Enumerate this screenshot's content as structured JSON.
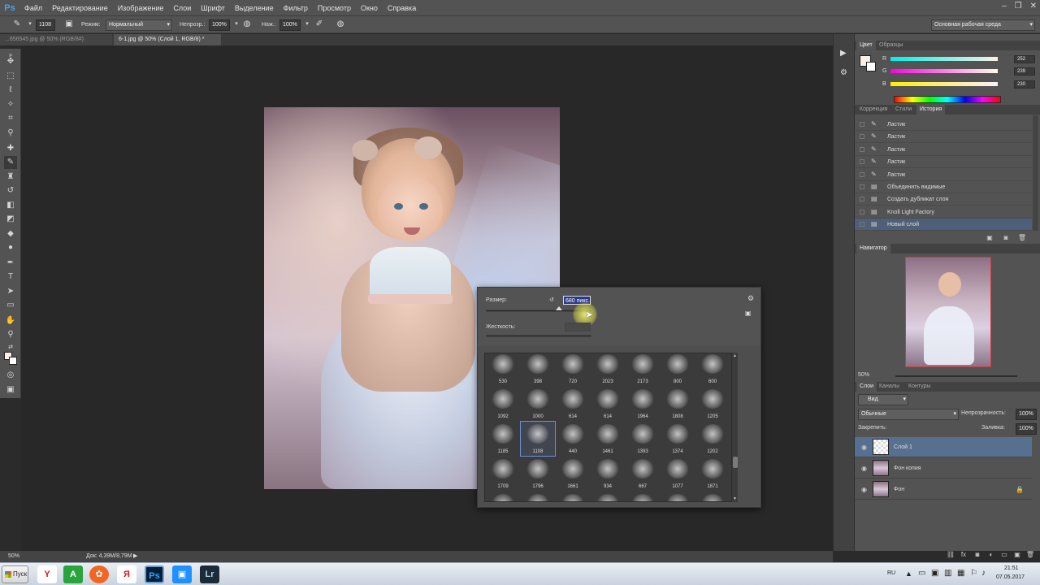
{
  "app": {
    "logo": "Ps"
  },
  "menu": [
    "Файл",
    "Редактирование",
    "Изображение",
    "Слои",
    "Шрифт",
    "Выделение",
    "Фильтр",
    "Просмотр",
    "Окно",
    "Справка"
  ],
  "window_controls": [
    "–",
    "❐",
    "✕"
  ],
  "options": {
    "size": "1108",
    "mode_label": "Режим:",
    "mode_value": "Нормальный",
    "opacity_label": "Непрозр.:",
    "opacity_value": "100%",
    "flow_label": "Наж.:",
    "flow_value": "100%",
    "workspace": "Основная рабочая среда"
  },
  "tabs": [
    {
      "label": "...656545.jpg @ 50% (RGB/8#)",
      "active": false
    },
    {
      "label": "6-1.jpg @ 50% (Слой 1, RGB/8) *",
      "active": true
    }
  ],
  "tools": [
    "move-tool",
    "marquee-tool",
    "lasso-tool",
    "quick-select-tool",
    "crop-tool",
    "eyedropper-tool",
    "healing-tool",
    "brush-tool",
    "stamp-tool",
    "history-brush-tool",
    "eraser-tool",
    "gradient-tool",
    "blur-tool",
    "dodge-tool",
    "pen-tool",
    "type-tool",
    "path-select-tool",
    "shape-tool",
    "hand-tool",
    "zoom-tool"
  ],
  "brush_picker": {
    "size_label": "Размер:",
    "size_value": "680 пикс.",
    "hardness_label": "Жесткость:",
    "brushes": [
      {
        "n": "530"
      },
      {
        "n": "398"
      },
      {
        "n": "720"
      },
      {
        "n": "2023"
      },
      {
        "n": "2173"
      },
      {
        "n": "800"
      },
      {
        "n": "600"
      },
      {
        "n": "1092"
      },
      {
        "n": "1000"
      },
      {
        "n": "614"
      },
      {
        "n": "614"
      },
      {
        "n": "1964"
      },
      {
        "n": "1808"
      },
      {
        "n": "1205"
      },
      {
        "n": "1185"
      },
      {
        "n": "1108",
        "selected": true
      },
      {
        "n": "440"
      },
      {
        "n": "1461"
      },
      {
        "n": "1393"
      },
      {
        "n": "1374"
      },
      {
        "n": "1202"
      },
      {
        "n": "1709"
      },
      {
        "n": "1796"
      },
      {
        "n": "1661"
      },
      {
        "n": "934"
      },
      {
        "n": "667"
      },
      {
        "n": "1077"
      },
      {
        "n": "1871"
      },
      {
        "n": ""
      },
      {
        "n": ""
      },
      {
        "n": ""
      },
      {
        "n": ""
      },
      {
        "n": ""
      },
      {
        "n": ""
      },
      {
        "n": ""
      }
    ]
  },
  "color_panel": {
    "tabs": [
      "Цвет",
      "Образцы"
    ],
    "r_label": "R",
    "g_label": "G",
    "b_label": "B",
    "r": "252",
    "g": "239",
    "b": "230"
  },
  "history_panel": {
    "tabs": [
      "Коррекция",
      "Стили",
      "История"
    ],
    "items": [
      {
        "label": "Ластик"
      },
      {
        "label": "Ластик"
      },
      {
        "label": "Ластик"
      },
      {
        "label": "Ластик"
      },
      {
        "label": "Ластик"
      },
      {
        "label": "Объединить видимые"
      },
      {
        "label": "Создать дубликат слоя"
      },
      {
        "label": "Knoll Light Factory"
      },
      {
        "label": "Новый слой",
        "active": true
      }
    ]
  },
  "navigator": {
    "tab": "Навигатор",
    "zoom": "50%"
  },
  "layers_panel": {
    "tabs": [
      "Слои",
      "Каналы",
      "Контуры"
    ],
    "kind": "Вид",
    "blend": "Обычные",
    "opacity_label": "Непрозрачность:",
    "opacity_value": "100%",
    "lock_label": "Закрепить:",
    "fill_label": "Заливка:",
    "fill_value": "100%",
    "layers": [
      {
        "name": "Слой 1",
        "active": true
      },
      {
        "name": "Фон копия"
      },
      {
        "name": "Фон",
        "locked": true
      }
    ]
  },
  "status": {
    "zoom": "50%",
    "doc": "Док: 4,39M/8,79M"
  },
  "taskbar": {
    "start": "Пуск",
    "lang": "RU",
    "time": "21:51",
    "date": "07.05.2017"
  },
  "colors": {
    "accent_history": "#4e6079",
    "accent_layer": "#58708f",
    "nav_frame": "#d23a3a"
  }
}
